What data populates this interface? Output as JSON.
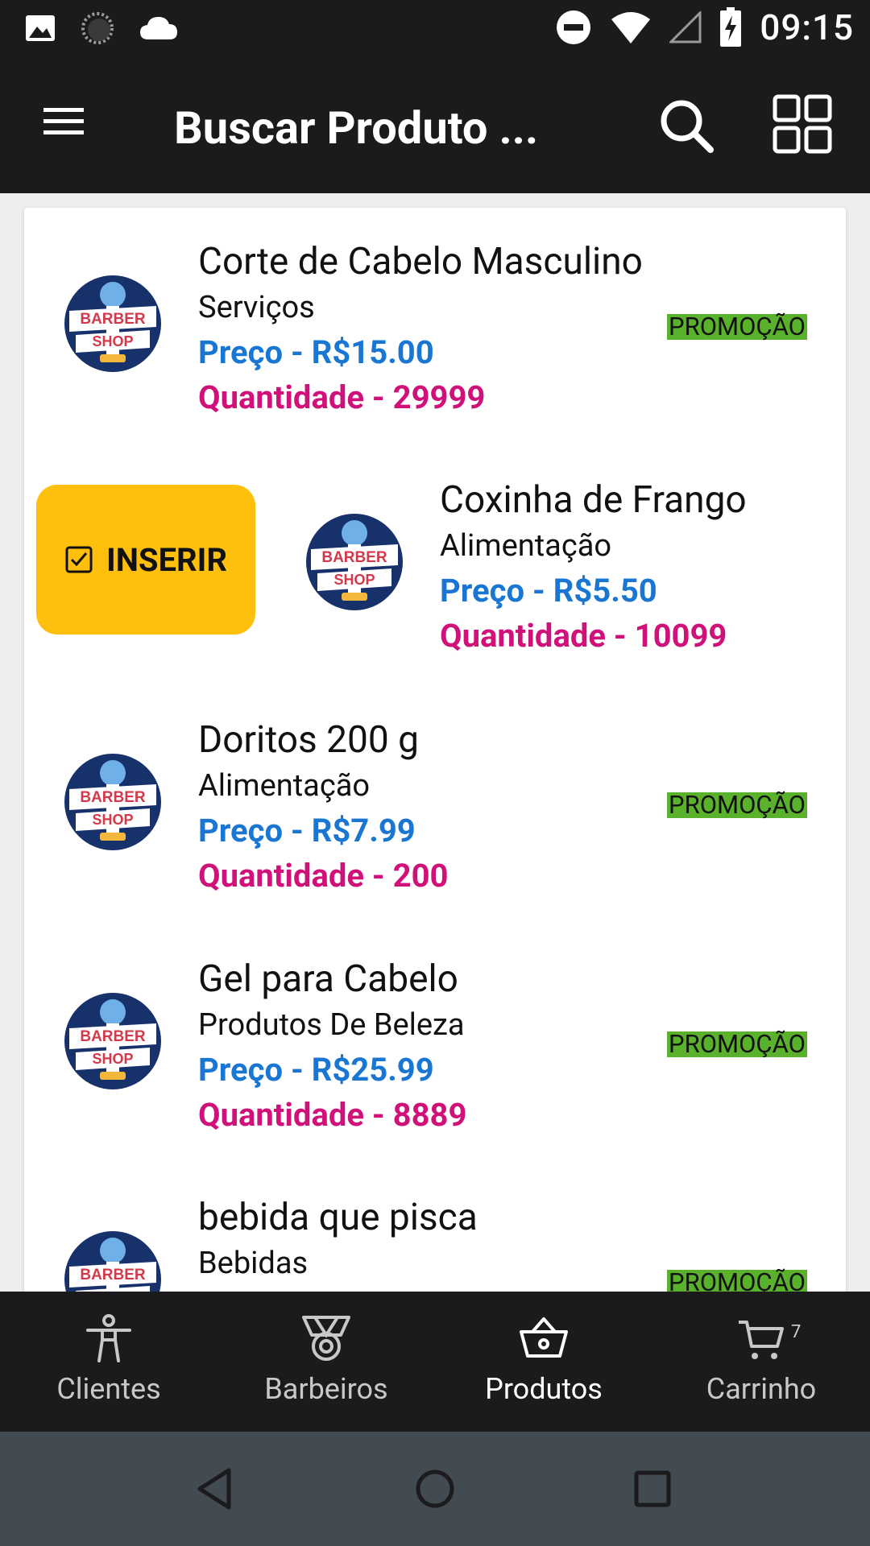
{
  "status_bar": {
    "time": "09:15"
  },
  "app_bar": {
    "title": "Buscar Produto ..."
  },
  "products": [
    {
      "name": "Corte de Cabelo Masculino",
      "category": "Serviços",
      "price": "Preço - R$15.00",
      "quantity": "Quantidade - 29999",
      "badge": "PROMOÇÃO"
    },
    {
      "name": "Coxinha de Frango",
      "category": "Alimentação",
      "price": "Preço - R$5.50",
      "quantity": "Quantidade - 10099",
      "badge": ""
    },
    {
      "name": "Doritos 200 g",
      "category": "Alimentação",
      "price": "Preço - R$7.99",
      "quantity": "Quantidade - 200",
      "badge": "PROMOÇÃO"
    },
    {
      "name": "Gel para Cabelo",
      "category": "Produtos De Beleza",
      "price": "Preço - R$25.99",
      "quantity": "Quantidade - 8889",
      "badge": "PROMOÇÃO"
    },
    {
      "name": "bebida que pisca",
      "category": "Bebidas",
      "price": "",
      "quantity": "",
      "badge": "PROMOÇÃO"
    }
  ],
  "logo_text": {
    "top": "BARBER",
    "bottom": "SHOP"
  },
  "swipe_action": {
    "label": "INSERIR"
  },
  "bottom_nav": {
    "items": [
      {
        "label": "Clientes",
        "icon": "person-icon"
      },
      {
        "label": "Barbeiros",
        "icon": "medal-icon"
      },
      {
        "label": "Produtos",
        "icon": "basket-icon"
      },
      {
        "label": "Carrinho",
        "icon": "cart-icon"
      }
    ],
    "cart_badge": "7",
    "active": "Produtos"
  },
  "colors": {
    "bar_bg": "#1b1b1d",
    "price": "#1976d2",
    "quantity": "#d0117a",
    "promo_bg": "#5ab22c",
    "insert_bg": "#ffc00d",
    "sys_nav_bg": "#424a52"
  }
}
